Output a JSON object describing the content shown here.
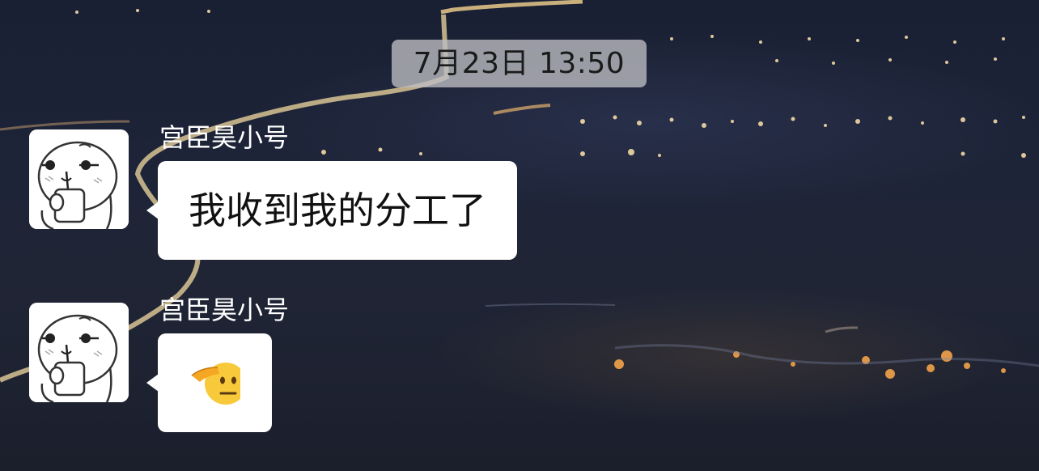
{
  "timestamp": "7月23日 13:50",
  "messages": [
    {
      "sender": "宫臣昊小号",
      "avatar_icon": "drinking-cartoon-avatar-icon",
      "type": "text",
      "text": "我收到我的分工了"
    },
    {
      "sender": "宫臣昊小号",
      "avatar_icon": "drinking-cartoon-avatar-icon",
      "type": "emoji",
      "emoji_icon": "saluting-face-icon"
    }
  ],
  "colors": {
    "bubble": "#ffffff",
    "timestamp_bg": "#bebec3",
    "sender_text": "#ffffff",
    "background": "#1c2133"
  }
}
